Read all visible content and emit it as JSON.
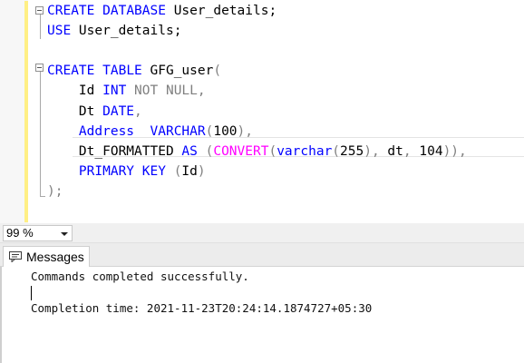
{
  "editor": {
    "lines": [
      [
        {
          "t": "CREATE",
          "c": "kw"
        },
        {
          "t": " ",
          "c": "tx"
        },
        {
          "t": "DATABASE",
          "c": "kw"
        },
        {
          "t": " User_details;",
          "c": "tx"
        }
      ],
      [
        {
          "t": "USE",
          "c": "kw"
        },
        {
          "t": " User_details;",
          "c": "tx"
        }
      ],
      [],
      [
        {
          "t": "CREATE",
          "c": "kw"
        },
        {
          "t": " ",
          "c": "tx"
        },
        {
          "t": "TABLE",
          "c": "kw"
        },
        {
          "t": " GFG_user",
          "c": "tx"
        },
        {
          "t": "(",
          "c": "gr"
        }
      ],
      [
        {
          "t": "    Id ",
          "c": "tx"
        },
        {
          "t": "INT",
          "c": "kw"
        },
        {
          "t": " ",
          "c": "tx"
        },
        {
          "t": "NOT NULL",
          "c": "gr"
        },
        {
          "t": ",",
          "c": "gr"
        }
      ],
      [
        {
          "t": "    Dt ",
          "c": "tx"
        },
        {
          "t": "DATE",
          "c": "kw"
        },
        {
          "t": ",",
          "c": "gr"
        }
      ],
      [
        {
          "t": "    Address  ",
          "c": "kw"
        },
        {
          "t": "VARCHAR",
          "c": "kw"
        },
        {
          "t": "(",
          "c": "gr"
        },
        {
          "t": "100",
          "c": "tx"
        },
        {
          "t": "),",
          "c": "gr"
        }
      ],
      [
        {
          "t": "    Dt_FORMATTED ",
          "c": "tx"
        },
        {
          "t": "AS",
          "c": "kw"
        },
        {
          "t": " ",
          "c": "tx"
        },
        {
          "t": "(",
          "c": "gr"
        },
        {
          "t": "CONVERT",
          "c": "fn"
        },
        {
          "t": "(",
          "c": "gr"
        },
        {
          "t": "varchar",
          "c": "kw"
        },
        {
          "t": "(",
          "c": "gr"
        },
        {
          "t": "255",
          "c": "tx"
        },
        {
          "t": "),",
          "c": "gr"
        },
        {
          "t": " dt",
          "c": "tx"
        },
        {
          "t": ",",
          "c": "gr"
        },
        {
          "t": " 104",
          "c": "tx"
        },
        {
          "t": ")),",
          "c": "gr"
        }
      ],
      [
        {
          "t": "    PRIMARY KEY",
          "c": "kw"
        },
        {
          "t": " ",
          "c": "tx"
        },
        {
          "t": "(",
          "c": "gr"
        },
        {
          "t": "Id",
          "c": "tx"
        },
        {
          "t": ")",
          "c": "gr"
        }
      ],
      [
        {
          "t": ");",
          "c": "gr"
        }
      ]
    ]
  },
  "zoom": {
    "value": "99 %"
  },
  "results": {
    "tab_label": "Messages",
    "message_success": "Commands completed successfully.",
    "completion_time": "Completion time: 2021-11-23T20:24:14.1874727+05:30"
  }
}
